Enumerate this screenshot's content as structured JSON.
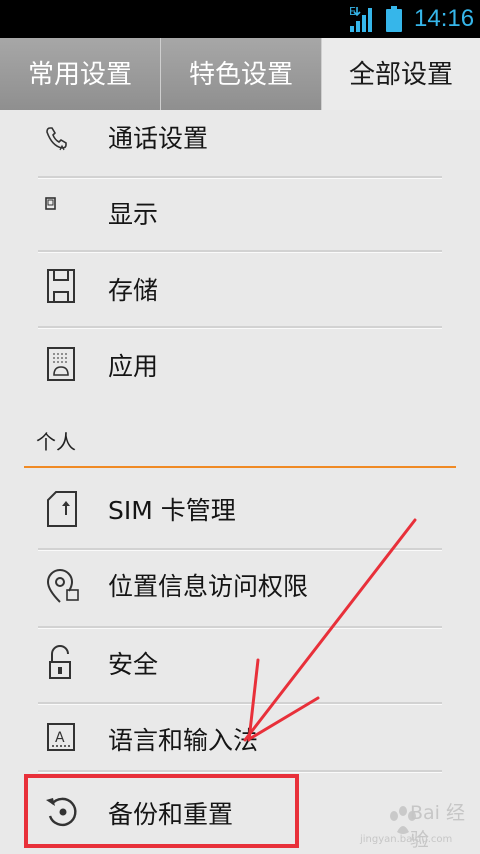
{
  "status_bar": {
    "network_badge": "E",
    "time": "14:16",
    "accent_color": "#36b6ea"
  },
  "tabs": [
    {
      "label": "常用设置",
      "selected": false
    },
    {
      "label": "特色设置",
      "selected": false
    },
    {
      "label": "全部设置",
      "selected": true
    }
  ],
  "items_group1": [
    {
      "label": "通话设置",
      "icon": "phone-icon"
    },
    {
      "label": "显示",
      "icon": "display-icon"
    },
    {
      "label": "存储",
      "icon": "storage-icon"
    },
    {
      "label": "应用",
      "icon": "apps-icon"
    }
  ],
  "section_personal": {
    "title": "个人",
    "accent_color": "#f08a24"
  },
  "items_group2": [
    {
      "label": "SIM 卡管理",
      "icon": "sim-card-icon"
    },
    {
      "label": "位置信息访问权限",
      "icon": "location-icon"
    },
    {
      "label": "安全",
      "icon": "lock-icon"
    },
    {
      "label": "语言和输入法",
      "icon": "keyboard-icon"
    },
    {
      "label": "备份和重置",
      "icon": "backup-restore-icon"
    }
  ],
  "annotation": {
    "color": "#e8303a",
    "highlighted_item": "备份和重置"
  },
  "watermark": {
    "text": "Bai 经验",
    "sub": "jingyan.baidu.com"
  }
}
